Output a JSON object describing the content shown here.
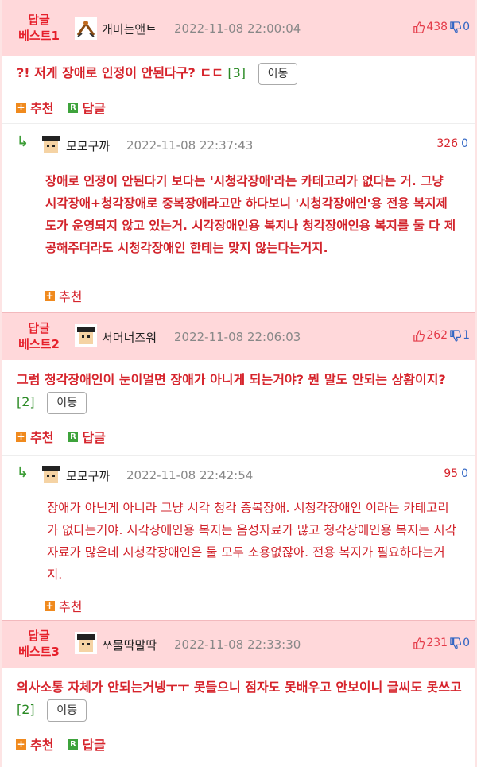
{
  "best1": {
    "badge": "답글\n베스트1",
    "user": "개미는앤트",
    "date": "2022-11-08 22:00:04",
    "up": "438",
    "down": "0",
    "title": "?! 저게 장애로 인정이 안된다구? ㄷㄷ",
    "count": "[3]",
    "move": "이동",
    "recommend": "추천",
    "reply": "답글"
  },
  "reply1": {
    "user": "모모구까",
    "date": "2022-11-08 22:37:43",
    "up": "326",
    "down": "0",
    "text": "장애로 인정이 안된다기 보다는 '시청각장애'라는 카테고리가 없다는 거. 그냥 시각장애+청각장애로 중복장애라고만 하다보니 '시청각장애인'용 전용 복지제도가 운영되지 않고 있는거. 시각장애인용 복지나 청각장애인용 복지를 둘 다 제공해주더라도 시청각장애인 한테는 맞지 않는다는거지.",
    "recommend": "추천"
  },
  "best2": {
    "badge": "답글\n베스트2",
    "user": "서머너즈워",
    "date": "2022-11-08 22:06:03",
    "up": "262",
    "down": "1",
    "title": "그럼 청각장애인이 눈이멀면 장애가 아니게 되는거야? 뭔 말도 안되는 상황이지?",
    "count": "[2]",
    "move": "이동",
    "recommend": "추천",
    "reply": "답글"
  },
  "reply2": {
    "user": "모모구까",
    "date": "2022-11-08 22:42:54",
    "up": "95",
    "down": "0",
    "text": "장애가 아닌게 아니라 그냥 시각 청각 중복장애. 시청각장애인 이라는 카테고리가 없다는거야. 시각장애인용 복지는 음성자료가 많고 청각장애인용 복지는 시각자료가 많은데 시청각장애인은 둘 모두 소용없잖아. 전용 복지가 필요하다는거지.",
    "recommend": "추천"
  },
  "best3": {
    "badge": "답글\n베스트3",
    "user": "쪼물딱말딱",
    "date": "2022-11-08 22:33:30",
    "up": "231",
    "down": "0",
    "title": "의사소통 자체가 안되는거넹ㅜㅜ 못들으니 점자도 못배우고 안보이니 글씨도 못쓰고",
    "count": "[2]",
    "move": "이동",
    "recommend": "추천",
    "reply": "답글"
  },
  "colors": {
    "accent_red": "#d6242c",
    "header_pink": "#ffd8da",
    "green": "#3d9d37",
    "blue": "#2f64c3"
  }
}
